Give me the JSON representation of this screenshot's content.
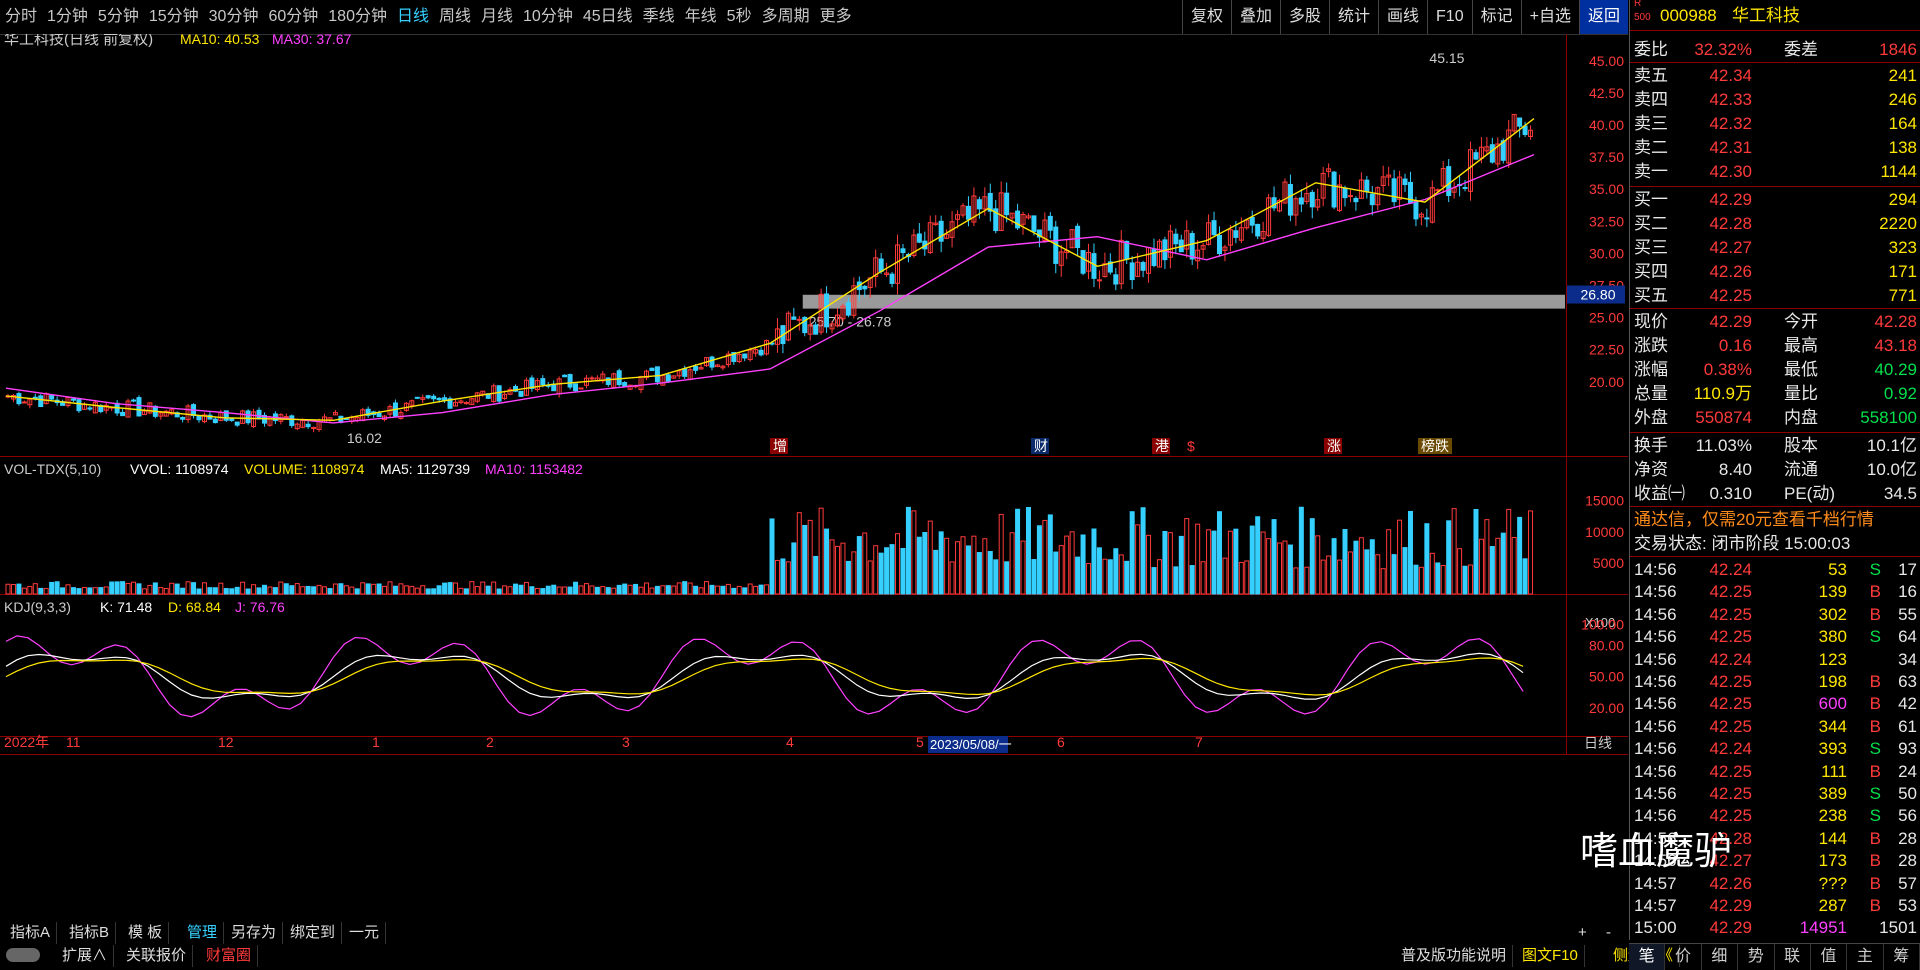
{
  "toolbar": {
    "periods": [
      "分时",
      "1分钟",
      "5分钟",
      "15分钟",
      "30分钟",
      "60分钟",
      "180分钟",
      "日线",
      "周线",
      "月线",
      "10分钟",
      "45日线",
      "季线",
      "年线",
      "5秒",
      "多周期",
      "更多"
    ],
    "active_period": "日线",
    "right_buttons": [
      "复权",
      "叠加",
      "多股",
      "统计",
      "画线",
      "F10",
      "标记",
      "+自选",
      "返回"
    ]
  },
  "chart": {
    "title": "华工科技(日线 前复权)",
    "ma10_label": "MA10: 40.53",
    "ma30_label": "MA30: 37.67",
    "price_axis": [
      "45.00",
      "42.50",
      "40.00",
      "37.50",
      "35.00",
      "32.50",
      "30.00",
      "27.50",
      "25.00",
      "22.50",
      "20.00"
    ],
    "current_price_tag": "26.80",
    "zone_label": "25.70 - 26.78",
    "high_label": "45.15",
    "low_label": "16.02",
    "events": [
      "增",
      "财",
      "港",
      "$",
      "涨",
      "榜跌"
    ],
    "vol_header": {
      "name": "VOL-TDX(5,10)",
      "vvol": "VVOL: 1108974",
      "volume": "VOLUME: 1108974",
      "ma5": "MA5: 1129739",
      "ma10": "MA10: 1153482"
    },
    "vol_axis": [
      "15000",
      "10000",
      "5000"
    ],
    "vol_unit": "X100",
    "kdj_header": {
      "name": "KDJ(9,3,3)",
      "k": "K: 71.48",
      "d": "D: 68.84",
      "j": "J: 76.76"
    },
    "kdj_axis": [
      "100.00",
      "80.00",
      "50.00",
      "20.00"
    ],
    "date_axis": [
      "2022年",
      "11",
      "12",
      "1",
      "2",
      "3",
      "4",
      "5",
      "6",
      "7"
    ],
    "cursor_date": "2023/05/08/一",
    "period_label": "日线",
    "colors": {
      "up": "#ff3a3a",
      "down": "#35d0ff",
      "ma10": "#ffe600",
      "ma30": "#ff40ff",
      "k": "#ffffff",
      "d": "#ffe600",
      "j": "#ff40ff"
    }
  },
  "chart_data": {
    "type": "line",
    "title": "华工科技(日线 前复权)",
    "series": [
      {
        "name": "MA10",
        "x": [
          0,
          20,
          40,
          60,
          80,
          100,
          120,
          140,
          160,
          180,
          200,
          220,
          240,
          260,
          280
        ],
        "values": [
          18.9,
          18.0,
          17.2,
          17.0,
          18.5,
          19.8,
          20.5,
          23.0,
          28.5,
          33.5,
          29.0,
          31.0,
          35.5,
          34.0,
          40.5
        ]
      },
      {
        "name": "MA30",
        "x": [
          0,
          20,
          40,
          60,
          80,
          100,
          120,
          140,
          160,
          180,
          200,
          220,
          240,
          260,
          280
        ],
        "values": [
          19.5,
          18.3,
          17.6,
          16.8,
          17.6,
          19.0,
          19.9,
          21.0,
          25.5,
          30.5,
          31.3,
          29.5,
          32.0,
          34.2,
          37.7
        ]
      }
    ],
    "ylim": [
      15,
      46
    ],
    "ylabel": "",
    "xlabel": "",
    "grid": false
  },
  "quote": {
    "code": "000988",
    "name": "华工科技",
    "badge_top": "R",
    "badge_bottom": "500",
    "weibi_label": "委比",
    "weibi": "32.32%",
    "weicha_label": "委差",
    "weicha": "1846",
    "asks": [
      {
        "label": "卖五",
        "price": "42.34",
        "vol": "241"
      },
      {
        "label": "卖四",
        "price": "42.33",
        "vol": "246"
      },
      {
        "label": "卖三",
        "price": "42.32",
        "vol": "164"
      },
      {
        "label": "卖二",
        "price": "42.31",
        "vol": "138"
      },
      {
        "label": "卖一",
        "price": "42.30",
        "vol": "1144"
      }
    ],
    "bids": [
      {
        "label": "买一",
        "price": "42.29",
        "vol": "294"
      },
      {
        "label": "买二",
        "price": "42.28",
        "vol": "2220"
      },
      {
        "label": "买三",
        "price": "42.27",
        "vol": "323"
      },
      {
        "label": "买四",
        "price": "42.26",
        "vol": "171"
      },
      {
        "label": "买五",
        "price": "42.25",
        "vol": "771"
      }
    ],
    "stats": [
      {
        "l1": "现价",
        "v1": "42.29",
        "c1": "red",
        "l2": "今开",
        "v2": "42.28",
        "c2": "red"
      },
      {
        "l1": "涨跌",
        "v1": "0.16",
        "c1": "red",
        "l2": "最高",
        "v2": "43.18",
        "c2": "red"
      },
      {
        "l1": "涨幅",
        "v1": "0.38%",
        "c1": "red",
        "l2": "最低",
        "v2": "40.29",
        "c2": "green"
      },
      {
        "l1": "总量",
        "v1": "110.9万",
        "c1": "yellow",
        "l2": "量比",
        "v2": "0.92",
        "c2": "green"
      },
      {
        "l1": "外盘",
        "v1": "550874",
        "c1": "red",
        "l2": "内盘",
        "v2": "558100",
        "c2": "green"
      }
    ],
    "stats2": [
      {
        "l1": "换手",
        "v1": "11.03%",
        "l2": "股本",
        "v2": "10.1亿"
      },
      {
        "l1": "净资",
        "v1": "8.40",
        "l2": "流通",
        "v2": "10.0亿"
      },
      {
        "l1": "收益㈠",
        "v1": "0.310",
        "l2": "PE(动)",
        "v2": "34.5"
      }
    ],
    "ad_text": "通达信，仅需20元查看千档行情",
    "trade_status": "交易状态: 闭市阶段 15:00:03",
    "ticks": [
      {
        "t": "14:56",
        "p": "42.24",
        "v": "53",
        "s": "S",
        "n": "17"
      },
      {
        "t": "14:56",
        "p": "42.25",
        "v": "139",
        "s": "B",
        "n": "16"
      },
      {
        "t": "14:56",
        "p": "42.25",
        "v": "302",
        "s": "B",
        "n": "55"
      },
      {
        "t": "14:56",
        "p": "42.25",
        "v": "380",
        "s": "S",
        "n": "64"
      },
      {
        "t": "14:56",
        "p": "42.24",
        "v": "123",
        "s": "",
        "n": "34"
      },
      {
        "t": "14:56",
        "p": "42.25",
        "v": "198",
        "s": "B",
        "n": "63"
      },
      {
        "t": "14:56",
        "p": "42.25",
        "v": "600",
        "s": "B",
        "n": "42"
      },
      {
        "t": "14:56",
        "p": "42.25",
        "v": "344",
        "s": "B",
        "n": "61"
      },
      {
        "t": "14:56",
        "p": "42.24",
        "v": "393",
        "s": "S",
        "n": "93"
      },
      {
        "t": "14:56",
        "p": "42.25",
        "v": "111",
        "s": "B",
        "n": "24"
      },
      {
        "t": "14:56",
        "p": "42.25",
        "v": "389",
        "s": "S",
        "n": "50"
      },
      {
        "t": "14:56",
        "p": "42.25",
        "v": "238",
        "s": "S",
        "n": "56"
      },
      {
        "t": "14:56",
        "p": "42.28",
        "v": "144",
        "s": "B",
        "n": "28"
      },
      {
        "t": "14:56",
        "p": "42.27",
        "v": "173",
        "s": "B",
        "n": "28"
      },
      {
        "t": "14:57",
        "p": "42.26",
        "v": "???",
        "s": "B",
        "n": "57"
      },
      {
        "t": "14:57",
        "p": "42.29",
        "v": "287",
        "s": "B",
        "n": "53"
      },
      {
        "t": "15:00",
        "p": "42.29",
        "v": "14951",
        "s": "",
        "n": "1501"
      }
    ],
    "panel_tabs": [
      "笔",
      "价",
      "细",
      "势",
      "联",
      "值",
      "主",
      "筹"
    ]
  },
  "bottom": {
    "row1": [
      "指标A",
      "指标B",
      "模 板",
      "管理",
      "另存为",
      "绑定到",
      "一元"
    ],
    "row2": [
      "扩展∧",
      "关联报价",
      "财富圈"
    ],
    "right_notes": [
      "普及版功能说明",
      "图文F10",
      "侧边栏《"
    ],
    "plus": "+",
    "minus": "-"
  },
  "watermark": "嗜血魔驴"
}
